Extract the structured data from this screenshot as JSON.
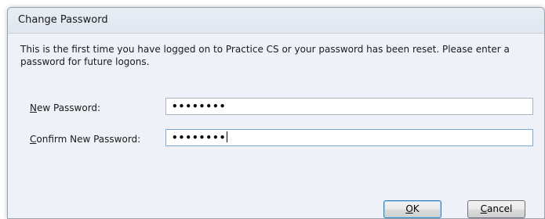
{
  "dialog": {
    "title": "Change Password",
    "message": "This is the first time you have logged on to Practice CS or your password has been reset. Please enter a password for future logons."
  },
  "fields": {
    "new_password": {
      "label_accel": "N",
      "label_rest": "ew Password:",
      "value": "••••••••"
    },
    "confirm_password": {
      "label_accel": "C",
      "label_rest": "onfirm New Password:",
      "value": "••••••••"
    }
  },
  "buttons": {
    "ok": {
      "accel": "O",
      "rest": "K"
    },
    "cancel": {
      "accel": "C",
      "rest": "ancel"
    }
  },
  "colors": {
    "titlebar": "#dfe6ef",
    "client_background": "#eef2f8",
    "default_button_border": "#3c7fb1"
  }
}
